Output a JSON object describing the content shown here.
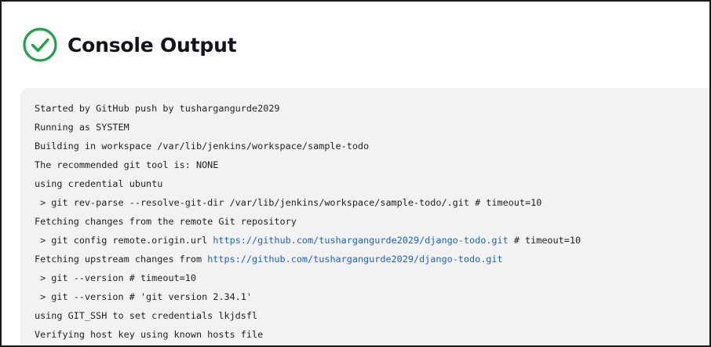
{
  "page": {
    "title": "Console Output",
    "status": "success",
    "status_icon": "check-circle-icon",
    "status_color": "#1ea446"
  },
  "console": {
    "background": "#f2f2f3",
    "link_color": "#1a63c7",
    "lines": [
      {
        "segments": [
          {
            "text": "Started by GitHub push by tushargangurde2029"
          }
        ]
      },
      {
        "segments": [
          {
            "text": "Running as SYSTEM"
          }
        ]
      },
      {
        "segments": [
          {
            "text": "Building in workspace /var/lib/jenkins/workspace/sample-todo"
          }
        ]
      },
      {
        "segments": [
          {
            "text": "The recommended git tool is: NONE"
          }
        ]
      },
      {
        "segments": [
          {
            "text": "using credential ubuntu"
          }
        ]
      },
      {
        "segments": [
          {
            "text": " > git rev-parse --resolve-git-dir /var/lib/jenkins/workspace/sample-todo/.git # timeout=10"
          }
        ]
      },
      {
        "segments": [
          {
            "text": "Fetching changes from the remote Git repository"
          }
        ]
      },
      {
        "segments": [
          {
            "text": " > git config remote.origin.url "
          },
          {
            "text": "https://github.com/tushargangurde2029/django-todo.git",
            "link": true
          },
          {
            "text": " # timeout=10"
          }
        ]
      },
      {
        "segments": [
          {
            "text": "Fetching upstream changes from "
          },
          {
            "text": "https://github.com/tushargangurde2029/django-todo.git",
            "link": true
          }
        ]
      },
      {
        "segments": [
          {
            "text": " > git --version # timeout=10"
          }
        ]
      },
      {
        "segments": [
          {
            "text": " > git --version # 'git version 2.34.1'"
          }
        ]
      },
      {
        "segments": [
          {
            "text": "using GIT_SSH to set credentials lkjdsfl"
          }
        ]
      },
      {
        "segments": [
          {
            "text": "Verifying host key using known hosts file"
          }
        ]
      }
    ]
  }
}
